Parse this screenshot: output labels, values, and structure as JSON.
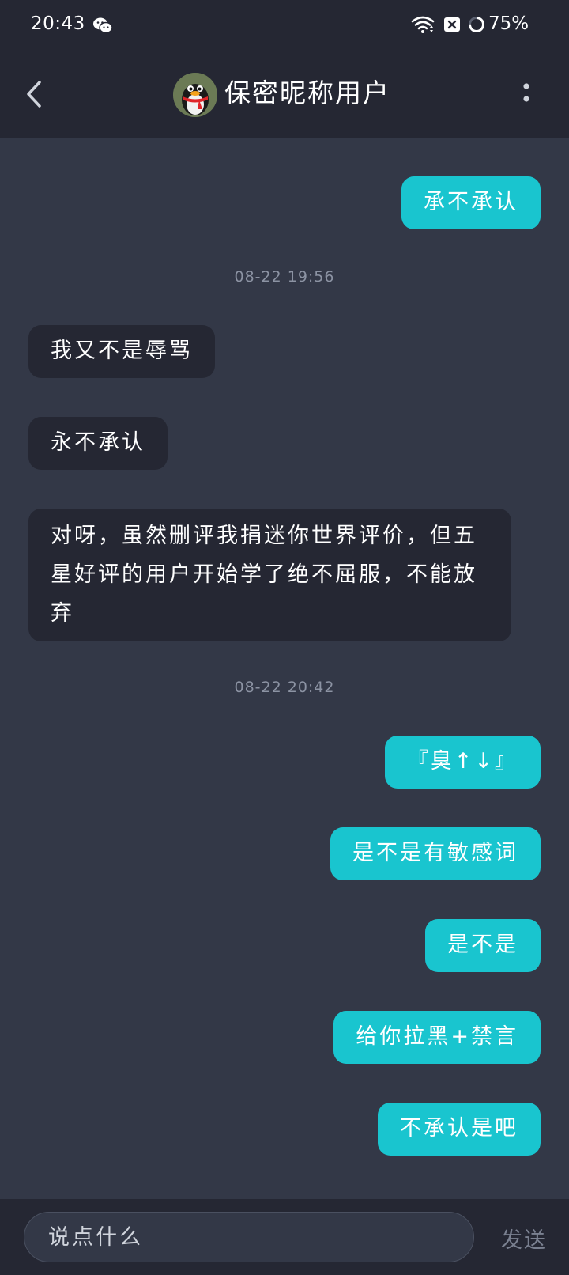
{
  "status_bar": {
    "time": "20:43",
    "battery": "75%",
    "icons": [
      "wechat-icon",
      "wifi-icon",
      "sim-icon",
      "battery-ring-icon"
    ]
  },
  "header": {
    "title": "保密昵称用户",
    "icons": [
      "back-arrow-icon",
      "penguin-avatar-icon",
      "more-vertical-icon"
    ]
  },
  "colors": {
    "outgoing_bubble": "#19c5cf",
    "incoming_bubble": "#252733",
    "background": "#333847",
    "bar": "#252733"
  },
  "messages": [
    {
      "type": "out",
      "text": "承不承认"
    },
    {
      "type": "timestamp",
      "text": "08-22 19:56"
    },
    {
      "type": "in",
      "text": "我又不是辱骂"
    },
    {
      "type": "in",
      "text": "永不承认"
    },
    {
      "type": "in",
      "text": "对呀，虽然删评我捐迷你世界评价，但五星好评的用户开始学了绝不屈服，不能放弃"
    },
    {
      "type": "timestamp",
      "text": "08-22 20:42"
    },
    {
      "type": "out",
      "text": "『臭↑↓』"
    },
    {
      "type": "out",
      "text": "是不是有敏感词"
    },
    {
      "type": "out",
      "text": "是不是"
    },
    {
      "type": "out",
      "text": "给你拉黑+禁言"
    },
    {
      "type": "out",
      "text": "不承认是吧"
    }
  ],
  "input": {
    "placeholder": "说点什么",
    "value": ""
  },
  "send_label": "发送"
}
